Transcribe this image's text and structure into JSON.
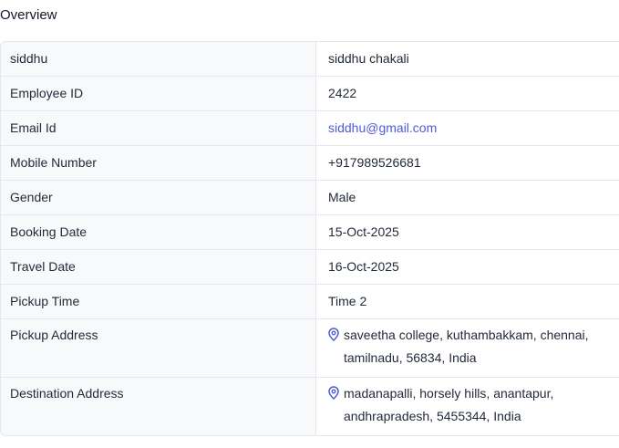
{
  "section_title": "Overview",
  "rows": [
    {
      "label": "siddhu",
      "value": "siddhu chakali"
    },
    {
      "label": "Employee ID",
      "value": "2422"
    },
    {
      "label": "Email Id",
      "value": "siddhu@gmail.com"
    },
    {
      "label": "Mobile Number",
      "value": "+917989526681"
    },
    {
      "label": "Gender",
      "value": "Male"
    },
    {
      "label": "Booking Date",
      "value": "15-Oct-2025"
    },
    {
      "label": "Travel Date",
      "value": "16-Oct-2025"
    },
    {
      "label": "Pickup Time",
      "value": "Time 2"
    },
    {
      "label": "Pickup Address",
      "value": "saveetha college, kuthambakkam, chennai, tamilnadu, 56834, India",
      "icon": "map-pin-icon"
    },
    {
      "label": "Destination Address",
      "value": "madanapalli, horsely hills, anantapur, andhrapradesh, 5455344, India",
      "icon": "map-pin-icon"
    }
  ],
  "colors": {
    "link": "#4f5bd5",
    "label_bg": "#f8f9fb",
    "border": "#e5e7eb"
  }
}
